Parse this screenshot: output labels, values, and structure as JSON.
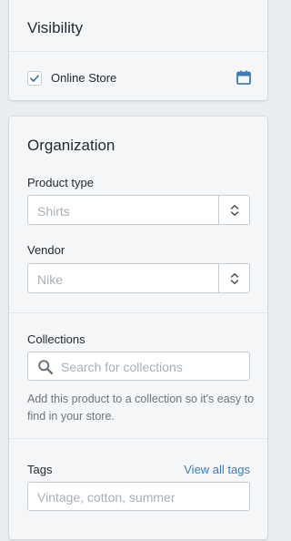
{
  "visibility": {
    "title": "Visibility",
    "channels": [
      {
        "label": "Online Store",
        "checked": true
      }
    ]
  },
  "organization": {
    "title": "Organization",
    "product_type": {
      "label": "Product type",
      "placeholder": "Shirts"
    },
    "vendor": {
      "label": "Vendor",
      "placeholder": "Nike"
    },
    "collections": {
      "label": "Collections",
      "search_placeholder": "Search for collections",
      "help": "Add this product to a collection so it's easy to find in your store."
    },
    "tags": {
      "label": "Tags",
      "view_all_link": "View all tags",
      "placeholder": "Vintage, cotton, summer"
    }
  },
  "colors": {
    "accent": "#3d7db5",
    "card_bg": "#f4f6f8",
    "page_bg": "#ebeef0"
  }
}
